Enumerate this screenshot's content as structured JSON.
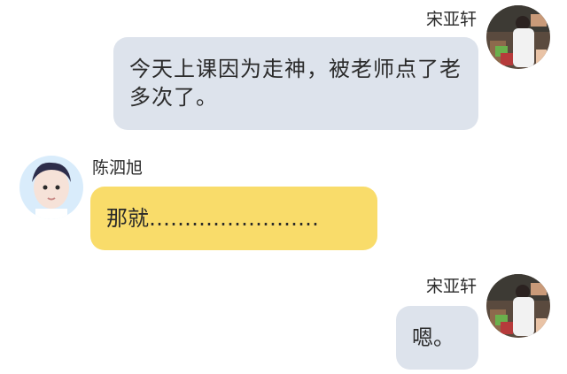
{
  "messages": [
    {
      "side": "right",
      "sender": "宋亚轩",
      "text": "今天上课因为走神，被老师点了老多次了。",
      "bubble_color": "#dde3ec"
    },
    {
      "side": "left",
      "sender": "陈泗旭",
      "text": "那就……………………",
      "bubble_color": "#f9dc6a"
    },
    {
      "side": "right",
      "sender": "宋亚轩",
      "text": "嗯。",
      "bubble_color": "#dde3ec"
    }
  ]
}
